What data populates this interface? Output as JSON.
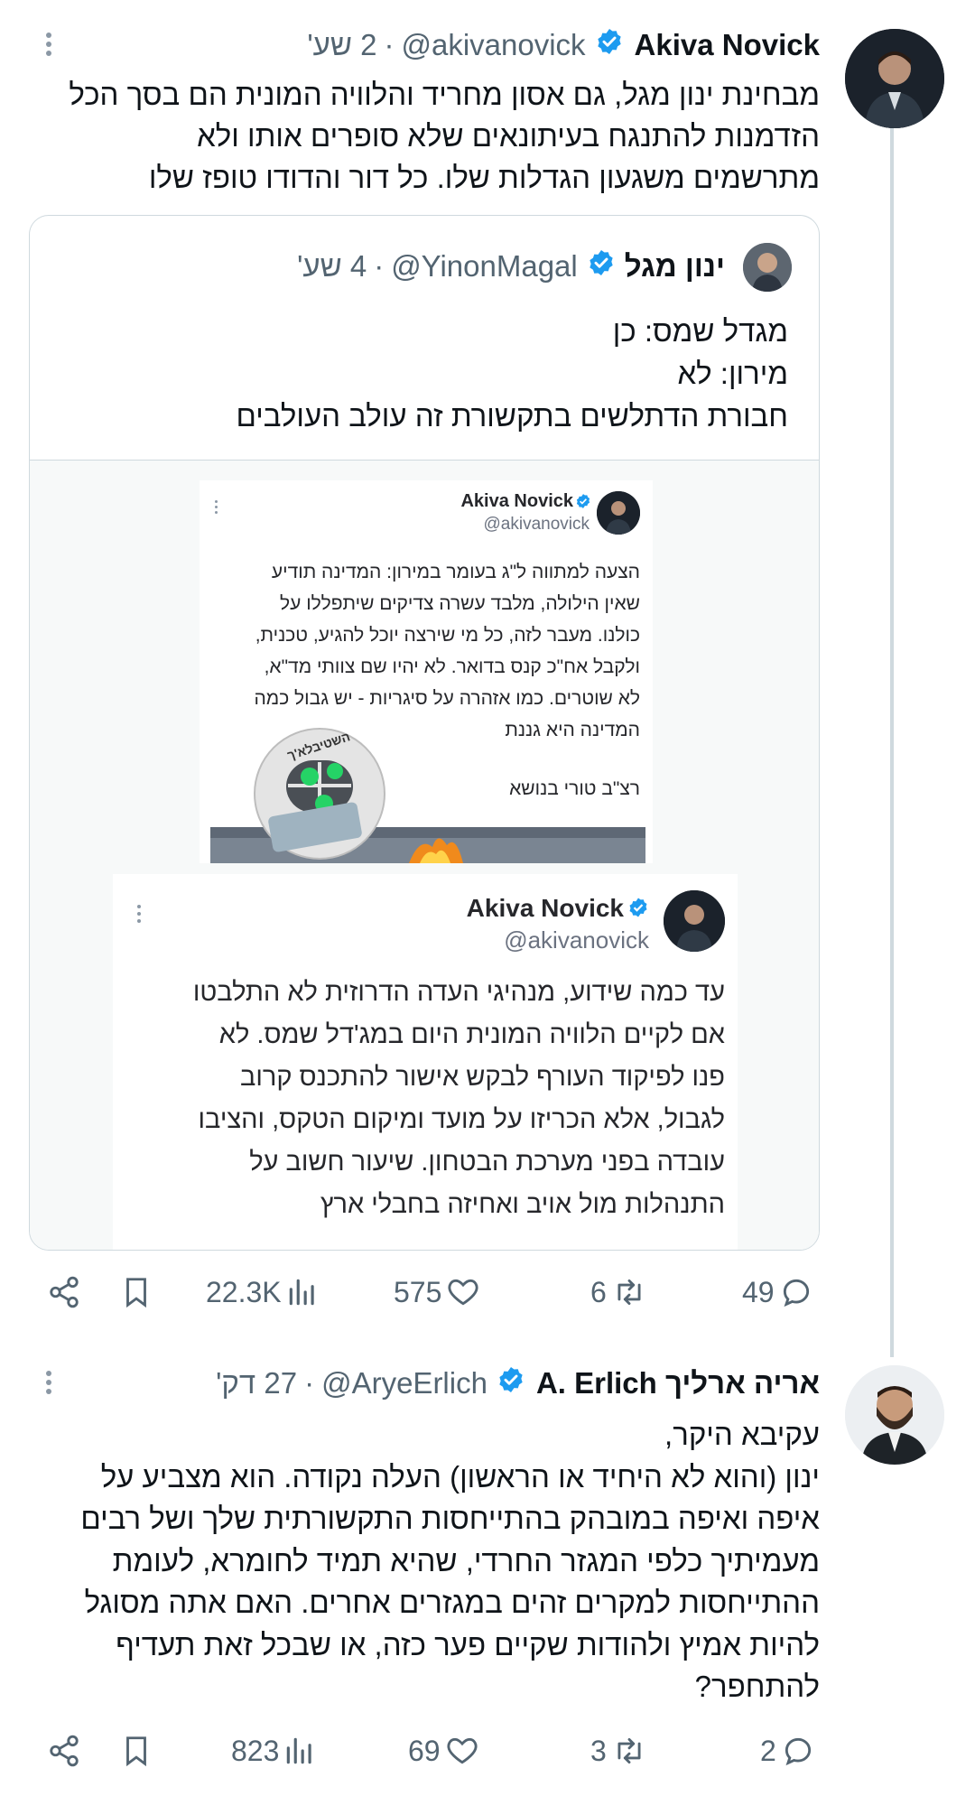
{
  "tweets": [
    {
      "display_name": "Akiva Novick",
      "handle": "@akivanovick",
      "time": "2 שע'",
      "lines": [
        "מבחינת ינון מגל, גם אסון מחריד והלוויה המונית הם בסך הכל",
        "הזדמנות להתנגח בעיתונאים שלא סופרים אותו ולא",
        "מתרשמים משגעון הגדלות שלו. כל דור והדודו טופז שלו"
      ],
      "quote": {
        "display_name": "ינון מגל",
        "handle": "@YinonMagal",
        "time": "4 שע'",
        "lines": [
          "מגדל שמס: כן",
          "מירון: לא",
          "חבורת הדתלשים בתקשורת זה עולב העולבים"
        ],
        "image_top": {
          "display_name": "Akiva Novick",
          "handle": "@akivanovick",
          "lines": [
            "הצעה למתווה ל\"ג בעומר במירון: המדינה תודיע",
            "שאין הילולה, מלבד עשרה צדיקים שיתפללו על",
            "כולנו. מעבר לזה, כל מי שירצה יוכל להגיע, טכנית,",
            "ולקבל אח\"כ קנס בדואר. לא יהיו שם צוותי מד\"א,",
            "לא שוטרים. כמו אזהרה על סיגריות - יש גבול כמה",
            "המדינה היא גננת"
          ],
          "footer": "רצ\"ב טורי בנושא",
          "logo_text": "השטיבלא'ך"
        },
        "image_bottom": {
          "display_name": "Akiva Novick",
          "handle": "@akivanovick",
          "lines": [
            "עד כמה שידוע, מנהיגי העדה הדרוזית לא התלבטו",
            "אם לקיים הלוויה המונית היום במג'דל שמס. לא",
            "פנו לפיקוד העורף לבקש אישור להתכנס קרוב",
            "לגבול, אלא הכריזו על מועד ומיקום הטקס, והציבו",
            "עובדה בפני מערכת הבטחון. שיעור חשוב על",
            "התנהלות מול אויב ואחיזה בחבלי ארץ"
          ]
        }
      },
      "stats": {
        "replies": "49",
        "reposts": "6",
        "likes": "575",
        "views": "22.3K"
      }
    },
    {
      "display_name": "אריה ארליך A. Erlich",
      "handle": "@AryeErlich",
      "time": "27 דק'",
      "lines": [
        "עקיבא היקר,",
        "ינון (והוא לא היחיד או הראשון) העלה נקודה. הוא מצביע על",
        "איפה ואיפה במובהק בהתייחסות התקשורתית שלך ושל רבים",
        "מעמיתיך כלפי המגזר החרדי, שהיא תמיד לחומרא, לעומת",
        "ההתייחסות למקרים זהים במגזרים אחרים. האם אתה מסוגל",
        "להיות אמיץ ולהודות שקיים פער כזה, או שבכל זאת תעדיף",
        "להתחפר?"
      ],
      "stats": {
        "replies": "2",
        "reposts": "3",
        "likes": "69",
        "views": "823"
      }
    }
  ],
  "icons": {
    "more": "more-dots-icon",
    "verified": "verified-badge-icon",
    "reply": "reply-icon",
    "repost": "repost-icon",
    "like": "like-icon",
    "views": "views-icon",
    "bookmark": "bookmark-icon",
    "share": "share-icon"
  },
  "colors": {
    "verified": "#1d9bf0",
    "text": "#0f1419",
    "muted": "#536471",
    "border": "#cfd9de"
  }
}
